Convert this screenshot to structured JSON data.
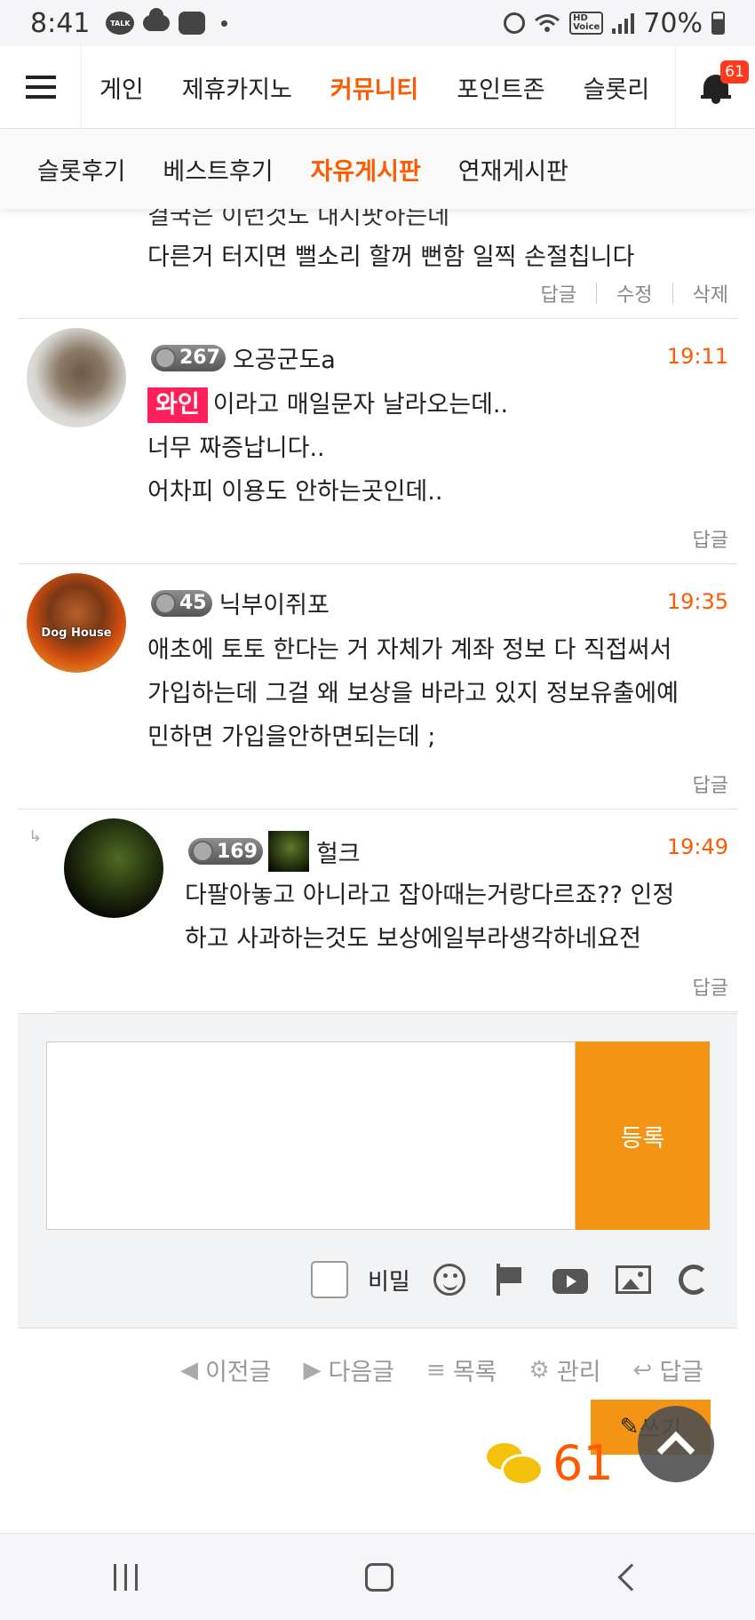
{
  "status_bar": {
    "time": "8:41",
    "talk": "TALK",
    "hd": "HD",
    "voice": "Voice",
    "battery": "70%"
  },
  "top_nav": {
    "items": [
      "게인",
      "제휴카지노",
      "커뮤니티",
      "포인트존",
      "슬롯리"
    ],
    "active_index": 2,
    "notification_count": "61"
  },
  "sub_nav": {
    "items": [
      "슬롯후기",
      "베스트후기",
      "자유게시판",
      "연재게시판"
    ],
    "active_index": 2
  },
  "partial_comment": {
    "line1": "결국은 이런것도 내시팟하는데",
    "line2": "다른거 터지면 뻘소리 할꺼 뻔함 일찍 손절칩니다",
    "actions": [
      "답글",
      "수정",
      "삭제"
    ]
  },
  "comments": [
    {
      "level": "267",
      "nickname": "오공군도a",
      "time": "19:11",
      "tag": "와인",
      "lines": [
        "이라고 매일문자 날라오는데..",
        "너무 짜증납니다..",
        "어차피 이용도 안하는곳인데.."
      ],
      "reply_label": "답글"
    },
    {
      "level": "45",
      "nickname": "닉부이쥐포",
      "time": "19:35",
      "lines": [
        "애초에 토토 한다는 거 자체가 계좌 정보 다 직접써서",
        "가입하는데 그걸 왜 보상을 바라고 있지 정보유출에예",
        "민하면 가입을안하면되는데 ;"
      ],
      "reply_label": "답글",
      "avatar_text": "Dog House"
    },
    {
      "level": "169",
      "nickname": "헐크",
      "time": "19:49",
      "lines": [
        "다팔아놓고 아니라고 잡아때는거랑다르죠?? 인정",
        "하고 사과하는것도 보상에일부라생각하네요전"
      ],
      "reply_label": "답글"
    }
  ],
  "composer": {
    "submit_label": "등록",
    "secret_label": "비밀"
  },
  "post_nav": {
    "items": [
      "이전글",
      "다음글",
      "목록",
      "관리",
      "답글"
    ]
  },
  "write_label": "쓰기",
  "comment_count": "61"
}
